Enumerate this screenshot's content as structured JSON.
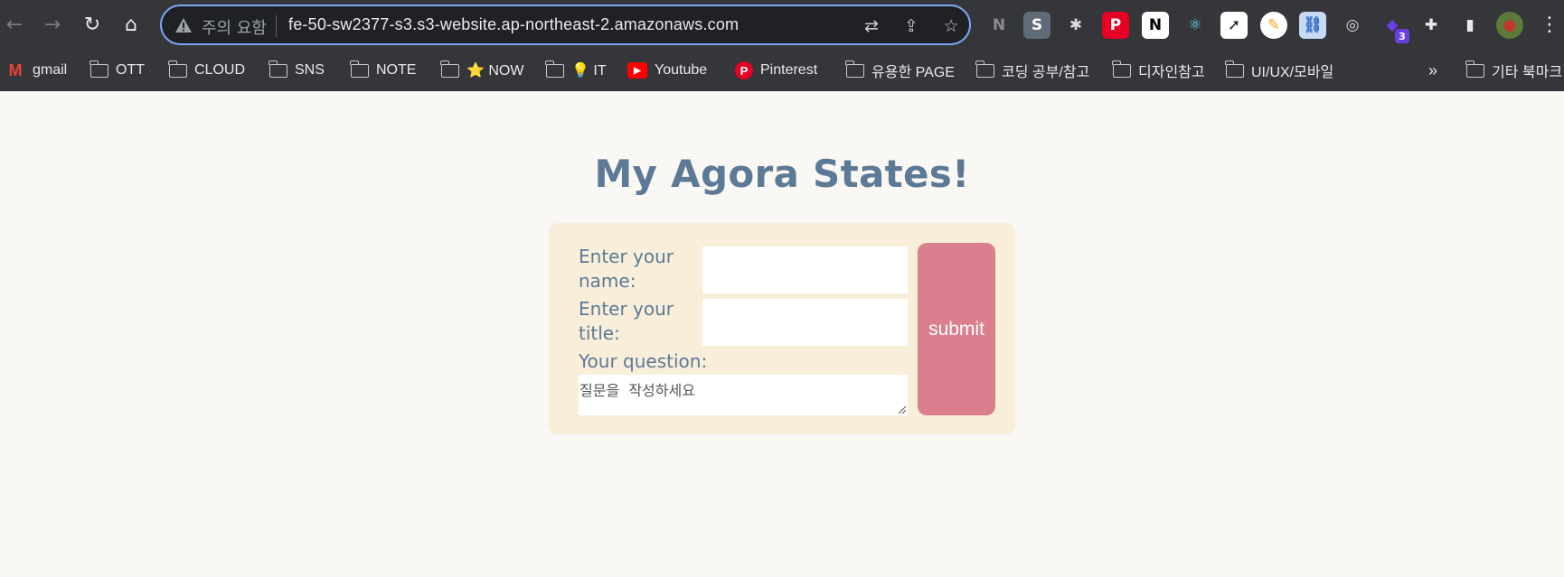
{
  "browser": {
    "security_label": "주의 요함",
    "url": "fe-50-sw2377-s3.s3-website.ap-northeast-2.amazonaws.com",
    "extensions": [
      {
        "icon": "n-stripes-extension-icon",
        "glyph": "N",
        "bg": "#35363a",
        "fg": "#8a8c90"
      },
      {
        "icon": "s-extension-icon",
        "glyph": "S",
        "bg": "#5f6b78",
        "fg": "#ffffff"
      },
      {
        "icon": "gear-extension-icon",
        "glyph": "✱",
        "bg": "#35363a",
        "fg": "#dadce0"
      },
      {
        "icon": "pinterest-extension-icon",
        "glyph": "P",
        "bg": "#e60023",
        "fg": "#ffffff"
      },
      {
        "icon": "notion-extension-icon",
        "glyph": "N",
        "bg": "#ffffff",
        "fg": "#000000"
      },
      {
        "icon": "react-devtools-icon",
        "glyph": "⚛",
        "bg": "#35363a",
        "fg": "#61dafb"
      },
      {
        "icon": "paper-plane-extension-icon",
        "glyph": "➚",
        "bg": "#ffffff",
        "fg": "#202124"
      },
      {
        "icon": "color-picker-extension-icon",
        "glyph": "✎",
        "bg": "#ffffff",
        "fg": "#f5a623"
      },
      {
        "icon": "link-extension-icon",
        "glyph": "⛓",
        "bg": "#c6d9f5",
        "fg": "#3b6fc4"
      },
      {
        "icon": "target-extension-icon",
        "glyph": "◎",
        "bg": "#35363a",
        "fg": "#dadce0"
      },
      {
        "icon": "gem-extension-icon",
        "glyph": "◆",
        "bg": "#35363a",
        "fg": "#6a3fe0",
        "badge": "3"
      },
      {
        "icon": "puzzle-extensions-icon",
        "glyph": "✚",
        "bg": "#35363a",
        "fg": "#e8eaed"
      },
      {
        "icon": "side-panel-icon",
        "glyph": "▮",
        "bg": "#35363a",
        "fg": "#e8eaed"
      },
      {
        "icon": "profile-avatar-icon",
        "glyph": "●",
        "bg": "#5b7a3c",
        "fg": "#c0392b"
      }
    ],
    "bookmarks": [
      {
        "label": "gmail",
        "icon": "gmail-icon"
      },
      {
        "label": "OTT",
        "icon": "folder-icon"
      },
      {
        "label": "CLOUD",
        "icon": "folder-icon"
      },
      {
        "label": "SNS",
        "icon": "folder-icon"
      },
      {
        "label": "NOTE",
        "icon": "folder-icon"
      },
      {
        "label": "⭐ NOW",
        "icon": "folder-icon"
      },
      {
        "label": "💡 IT",
        "icon": "folder-icon"
      },
      {
        "label": "Youtube",
        "icon": "youtube-icon"
      },
      {
        "label": "Pinterest",
        "icon": "pinterest-icon"
      },
      {
        "label": "유용한 PAGE",
        "icon": "folder-icon"
      },
      {
        "label": "코딩 공부/참고",
        "icon": "folder-icon"
      },
      {
        "label": "디자인참고",
        "icon": "folder-icon"
      },
      {
        "label": "UI/UX/모바일",
        "icon": "folder-icon"
      }
    ],
    "overflow_label": "»",
    "other_bookmarks": "기타 북마크"
  },
  "page": {
    "title": "My Agora States!",
    "form": {
      "name_label": "Enter your name:",
      "title_label": "Enter your title:",
      "question_label": "Your question:",
      "question_placeholder": "질문을  작성하세요",
      "submit_label": "submit"
    }
  },
  "colors": {
    "accent_text": "#5c7a96",
    "card_bg": "#f8eed9",
    "submit_bg": "#db7f8e",
    "page_bg": "#faf8f4"
  }
}
